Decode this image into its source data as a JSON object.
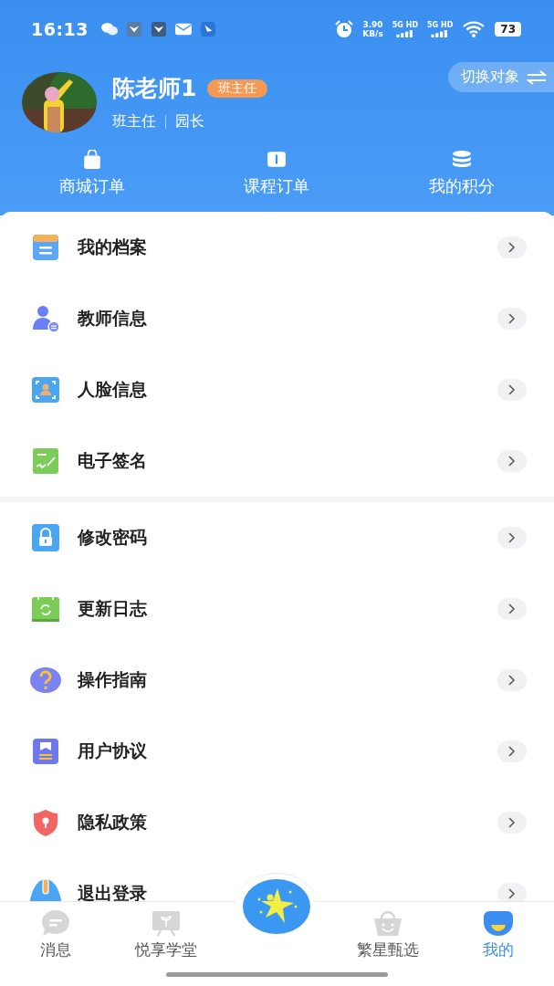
{
  "status_bar": {
    "time": "16:13",
    "speed": "3.90",
    "speed_unit": "KB/s",
    "sim_labels": [
      "5G HD",
      "5G HD"
    ],
    "battery": "73"
  },
  "profile": {
    "name": "陈老师1",
    "badge": "班主任",
    "roles": [
      "班主任",
      "园长"
    ],
    "switch_button": "切换对象"
  },
  "shortcuts": [
    {
      "label": "商城订单"
    },
    {
      "label": "课程订单"
    },
    {
      "label": "我的积分"
    }
  ],
  "menu_groups": [
    {
      "items": [
        {
          "label": "我的档案"
        },
        {
          "label": "教师信息"
        },
        {
          "label": "人脸信息"
        },
        {
          "label": "电子签名"
        }
      ]
    },
    {
      "items": [
        {
          "label": "修改密码"
        },
        {
          "label": "更新日志"
        },
        {
          "label": "操作指南"
        },
        {
          "label": "用户协议"
        },
        {
          "label": "隐私政策"
        },
        {
          "label": "退出登录"
        }
      ]
    }
  ],
  "tab_bar": [
    {
      "label": "消息",
      "selected": false
    },
    {
      "label": "悦享学堂",
      "selected": false
    },
    {
      "kind": "center"
    },
    {
      "label": "繁星甄选",
      "selected": false
    },
    {
      "label": "我的",
      "selected": true
    }
  ]
}
